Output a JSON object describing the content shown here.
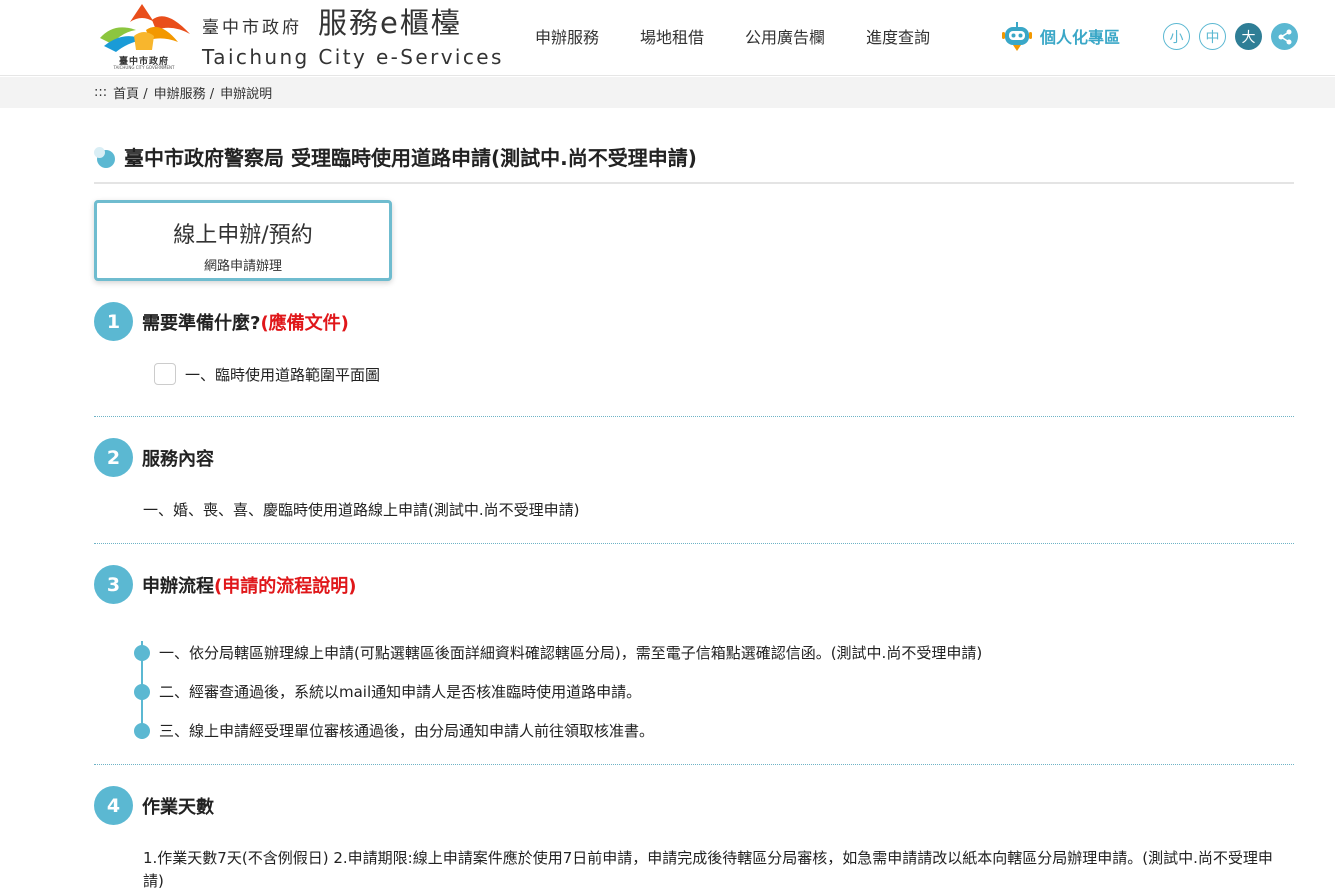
{
  "header": {
    "logo_text": "臺中市政府",
    "logo_sub": "TAICHUNG CITY GOVERNMENT",
    "gov_name": "臺中市政府",
    "site_title": "服務e櫃檯",
    "site_title_en": "Taichung City e-Services",
    "nav": [
      "申辦服務",
      "場地租借",
      "公用廣告欄",
      "進度查詢"
    ],
    "personal_label": "個人化專區",
    "font_sizes": [
      "小",
      "中",
      "大"
    ],
    "active_font_size": "大"
  },
  "breadcrumb": {
    "prefix": ":::",
    "items": [
      "首頁 /",
      "申辦服務 /",
      "申辦說明"
    ]
  },
  "page_title": "臺中市政府警察局 受理臨時使用道路申請(測試中.尚不受理申請)",
  "apply_button": {
    "main": "線上申辦/預約",
    "sub": "網路申請辦理"
  },
  "sections": {
    "s1": {
      "num": "1",
      "title": "需要準備什麼?",
      "title_note": "(應備文件)",
      "items": [
        "一、臨時使用道路範圍平面圖"
      ]
    },
    "s2": {
      "num": "2",
      "title": "服務內容",
      "text": "一、婚、喪、喜、慶臨時使用道路線上申請(測試中.尚不受理申請)"
    },
    "s3": {
      "num": "3",
      "title": "申辦流程",
      "title_note": "(申請的流程說明)",
      "steps": [
        "一、依分局轄區辦理線上申請(可點選轄區後面詳細資料確認轄區分局)，需至電子信箱點選確認信函。(測試中.尚不受理申請)",
        "二、經審查通過後，系統以mail通知申請人是否核准臨時使用道路申請。",
        "三、線上申請經受理單位審核通過後，由分局通知申請人前往領取核准書。"
      ]
    },
    "s4": {
      "num": "4",
      "title": "作業天數",
      "text": "1.作業天數7天(不含例假日) 2.申請期限:線上申請案件應於使用7日前申請，申請完成後待轄區分局審核，如急需申請請改以紙本向轄區分局辦理申請。(測試中.尚不受理申請)"
    }
  },
  "colors": {
    "accent": "#5bb8d2",
    "accent_dark": "#2f7e96",
    "note_red": "#e0171a",
    "personal_blue": "#3aa7c7"
  }
}
